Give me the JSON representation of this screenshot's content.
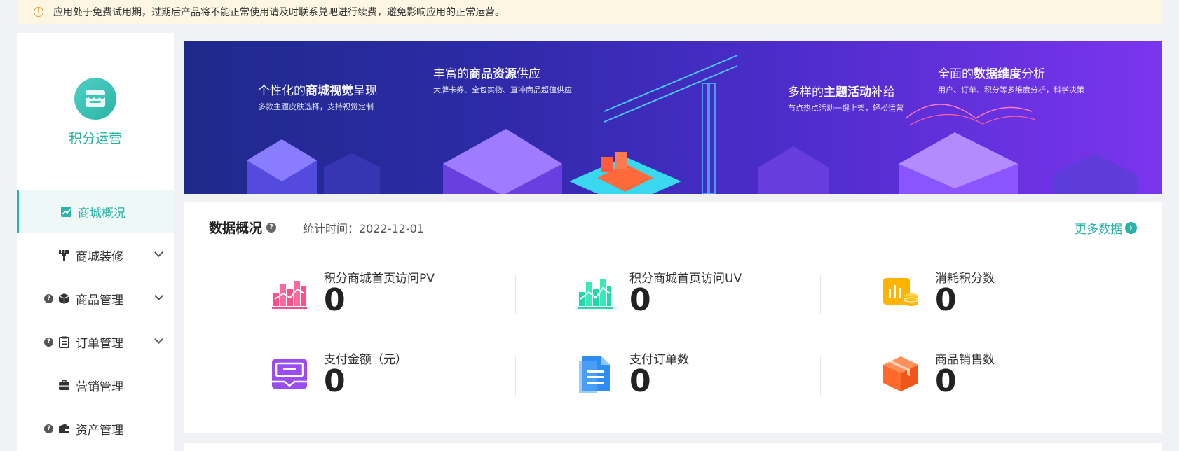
{
  "notice": {
    "text": "应用处于免费试用期，过期后产品将不能正常使用请及时联系兑吧进行续费，避免影响应用的正常运营。"
  },
  "brand": {
    "name": "积分运营"
  },
  "menu": [
    {
      "label": "商城概况",
      "icon": "chart-icon",
      "active": true,
      "help": false,
      "expand": false
    },
    {
      "label": "商城装修",
      "icon": "brush-icon",
      "active": false,
      "help": false,
      "expand": true
    },
    {
      "label": "商品管理",
      "icon": "box-icon",
      "active": false,
      "help": true,
      "expand": true
    },
    {
      "label": "订单管理",
      "icon": "clipboard-icon",
      "active": false,
      "help": true,
      "expand": true
    },
    {
      "label": "营销管理",
      "icon": "briefcase-icon",
      "active": false,
      "help": false,
      "expand": false
    },
    {
      "label": "资产管理",
      "icon": "wallet-icon",
      "active": false,
      "help": true,
      "expand": false
    }
  ],
  "banner": [
    {
      "head_pre": "个性化的",
      "head_bold": "商城视觉",
      "head_post": "呈现",
      "sub": "多款主题皮肤选择，支持视觉定制"
    },
    {
      "head_pre": "丰富的",
      "head_bold": "商品资源",
      "head_post": "供应",
      "sub": "大牌卡券、全包实物、直冲商品超值供应"
    },
    {
      "head_pre": "多样的",
      "head_bold": "主题活动",
      "head_post": "补给",
      "sub": "节点热点活动一键上架，轻松运营"
    },
    {
      "head_pre": "全面的",
      "head_bold": "数据维度",
      "head_post": "分析",
      "sub": "用户、订单、积分等多维度分析，科学决策"
    }
  ],
  "overview": {
    "title": "数据概况",
    "stat_time": "统计时间：2022-12-01",
    "more": "更多数据"
  },
  "metrics": [
    {
      "label": "积分商城首页访问PV",
      "value": "0",
      "icon": "pink-bar-chart-icon",
      "color": "#ff4f8b"
    },
    {
      "label": "积分商城首页访问UV",
      "value": "0",
      "icon": "green-bar-chart-icon",
      "color": "#1ed9a8"
    },
    {
      "label": "消耗积分数",
      "value": "0",
      "icon": "coin-chart-icon",
      "color": "#ffb400"
    },
    {
      "label": "支付金额（元）",
      "value": "0",
      "icon": "payment-box-icon",
      "color": "#9b4cf0"
    },
    {
      "label": "支付订单数",
      "value": "0",
      "icon": "document-icon",
      "color": "#2f8cf5"
    },
    {
      "label": "商品销售数",
      "value": "0",
      "icon": "package-icon",
      "color": "#ff6a2b"
    }
  ]
}
